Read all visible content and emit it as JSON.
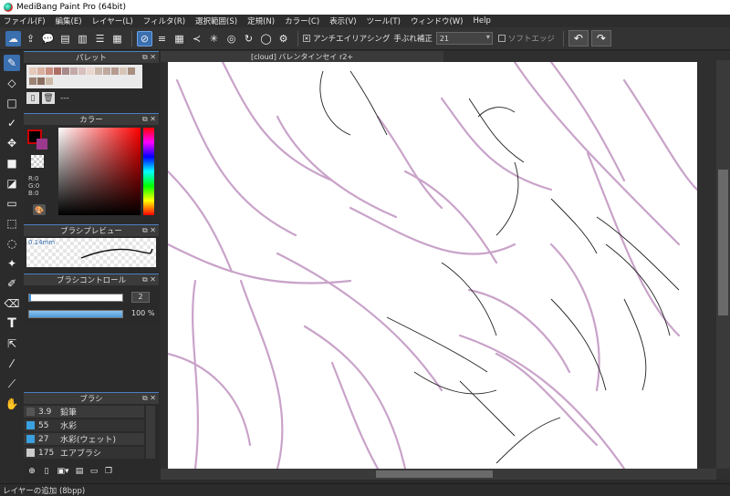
{
  "window": {
    "title": "MediBang Paint Pro (64bit)"
  },
  "menu": [
    "ファイル(F)",
    "編集(E)",
    "レイヤー(L)",
    "フィルタ(R)",
    "選択範囲(S)",
    "定規(N)",
    "カラー(C)",
    "表示(V)",
    "ツール(T)",
    "ウィンドウ(W)",
    "Help"
  ],
  "toolbar": {
    "antialias_label": "アンチエイリアシング",
    "antialias_checked": true,
    "stabilizer_label": "手ぶれ補正",
    "stabilizer_value": "21",
    "soft_edge_label": "ソフトエッジ",
    "soft_edge_checked": false
  },
  "palette": {
    "title": "パレット",
    "name": "---",
    "colors": [
      "#e6c9b8",
      "#d9b0a0",
      "#c98f80",
      "#b06f66",
      "#a88a8a",
      "#c3aaa8",
      "#d8c0bd",
      "#e9d6cf",
      "#c9b6a9",
      "#bfa89d",
      "#b59b90",
      "#d7c6b8",
      "#a88f80",
      "#9c8374",
      "#8a6f60",
      "#cbb9a6"
    ]
  },
  "color": {
    "title": "カラー",
    "r": "R:0",
    "g": "G:0",
    "b": "B:0"
  },
  "brush_preview": {
    "title": "ブラシプレビュー",
    "size": "0.14mm"
  },
  "brush_control": {
    "title": "ブラシコントロール",
    "size": "2",
    "opacity": "100 %"
  },
  "brush": {
    "title": "ブラシ",
    "items": [
      {
        "size": "3.9",
        "name": "鉛筆",
        "color": "#555555"
      },
      {
        "size": "55",
        "name": "水彩",
        "color": "#3aa0e0"
      },
      {
        "size": "27",
        "name": "水彩(ウェット)",
        "color": "#3aa0e0"
      },
      {
        "size": "175",
        "name": "エアブラシ",
        "color": "#cccccc"
      }
    ]
  },
  "document": {
    "tab": "[cloud] バレンタインセイ r2+"
  },
  "status": {
    "text": "レイヤーの追加 (8bpp)"
  }
}
